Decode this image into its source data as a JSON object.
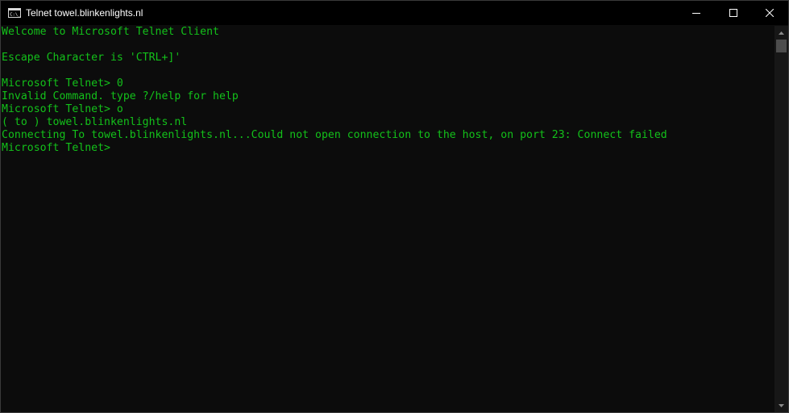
{
  "window": {
    "title": "Telnet towel.blinkenlights.nl",
    "icon": "console-icon",
    "controls": {
      "minimize": "minimize-icon",
      "maximize": "maximize-icon",
      "close": "close-icon"
    }
  },
  "console": {
    "text_color": "#13c11a",
    "background": "#0c0c0c",
    "lines": [
      "Welcome to Microsoft Telnet Client",
      "",
      "Escape Character is 'CTRL+]'",
      "",
      "Microsoft Telnet> 0",
      "Invalid Command. type ?/help for help",
      "Microsoft Telnet> o",
      "( to ) towel.blinkenlights.nl",
      "Connecting To towel.blinkenlights.nl...Could not open connection to the host, on port 23: Connect failed",
      "Microsoft Telnet>"
    ]
  },
  "scrollbar": {
    "up": "scroll-up-arrow-icon",
    "down": "scroll-down-arrow-icon"
  }
}
